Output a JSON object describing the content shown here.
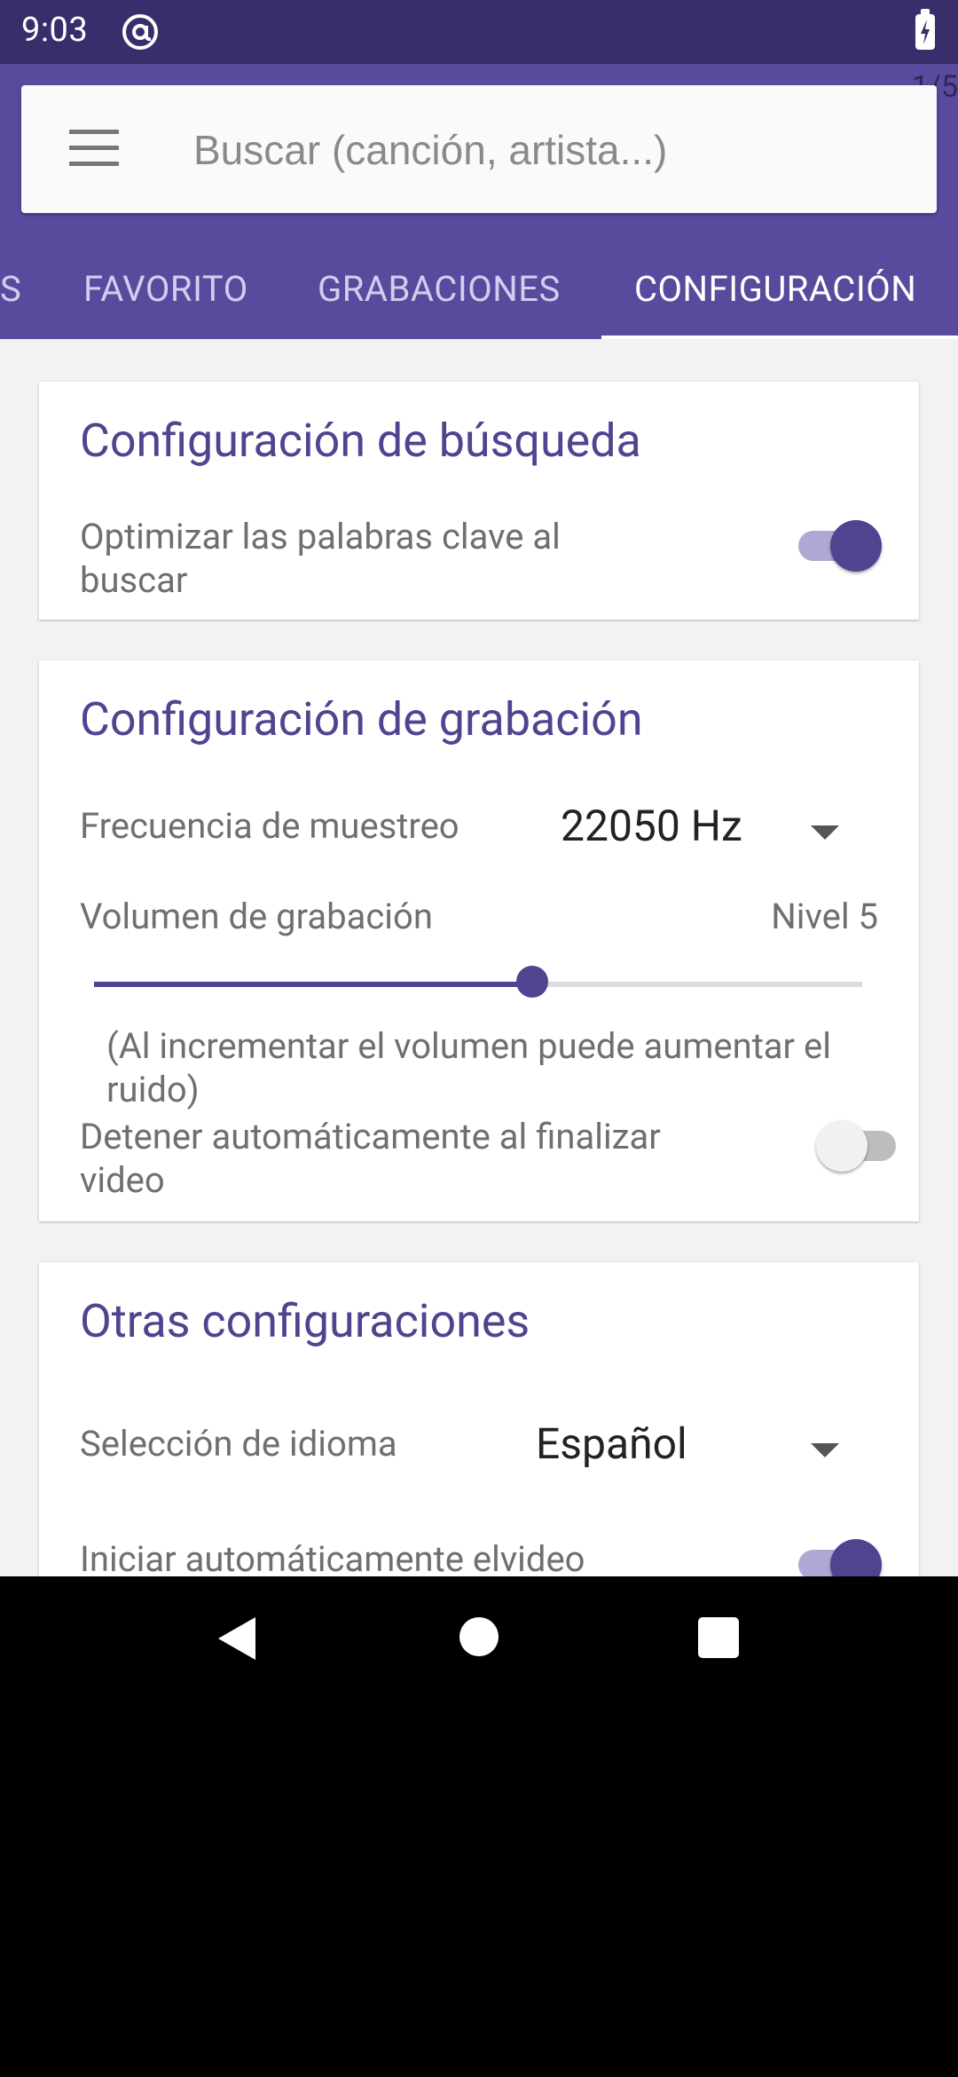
{
  "status_bar": {
    "time": "9:03"
  },
  "app_bar": {
    "page_counter": "1/5",
    "search_placeholder": "Buscar (canción, artista...)",
    "tabs": [
      "S",
      "FAVORITO",
      "GRABACIONES",
      "CONFIGURACIÓN"
    ],
    "active_tab": "CONFIGURACIÓN"
  },
  "search_settings": {
    "title": "Configuración de búsqueda",
    "optimize_label": "Optimizar las palabras clave al buscar",
    "optimize_on": true
  },
  "recording_settings": {
    "title": "Configuración de grabación",
    "sample_rate_label": "Frecuencia de muestreo",
    "sample_rate_value": "22050 Hz",
    "volume_label": "Volumen de grabación",
    "volume_value": "Nivel 5",
    "volume_fraction": 0.57,
    "volume_note": "(Al incrementar el volumen puede aumentar el ruido)",
    "auto_stop_label": "Detener automáticamente al finalizar video",
    "auto_stop_on": false
  },
  "other_settings": {
    "title": "Otras configuraciones",
    "language_label": "Selección de idioma",
    "language_value": "Español",
    "auto_start_label": "Iniciar automáticamente elvideo",
    "auto_start_on": true
  },
  "colors": {
    "primary": "#5a4a9e",
    "status_bar": "#3a2d6b",
    "accent": "#50438f"
  },
  "nav_bar": {
    "icons": [
      "back-icon",
      "home-icon",
      "recent-apps-icon"
    ]
  }
}
